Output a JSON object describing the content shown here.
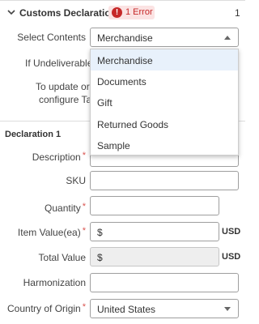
{
  "section": {
    "title": "Customs Declarations",
    "error_badge": "1 Error",
    "error_glyph": "!",
    "count": "1"
  },
  "select_contents": {
    "label": "Select Contents",
    "value": "Merchandise",
    "options": [
      "Merchandise",
      "Documents",
      "Gift",
      "Returned Goods",
      "Sample"
    ]
  },
  "if_undeliverable": {
    "label": "If Undeliverable"
  },
  "tax_note": {
    "line1": "To update orde",
    "line2": "configure Tax"
  },
  "declaration": {
    "title": "Declaration 1",
    "description": {
      "label": "Description",
      "required_mark": "*",
      "value": ""
    },
    "sku": {
      "label": "SKU",
      "value": ""
    },
    "quantity": {
      "label": "Quantity",
      "required_mark": "*",
      "value": ""
    },
    "item_value": {
      "label": "Item Value(ea)",
      "required_mark": "*",
      "prefix": "$",
      "unit": "USD"
    },
    "total_value": {
      "label": "Total Value",
      "prefix": "$",
      "unit": "USD"
    },
    "harmonization": {
      "label": "Harmonization",
      "value": ""
    },
    "country_of_origin": {
      "label": "Country of Origin",
      "required_mark": "*",
      "value": "United States"
    }
  },
  "colors": {
    "error": "#c62828",
    "error_bg": "#fbe3e3",
    "required": "#d9534f",
    "active_option_bg": "#e8f1fb"
  }
}
